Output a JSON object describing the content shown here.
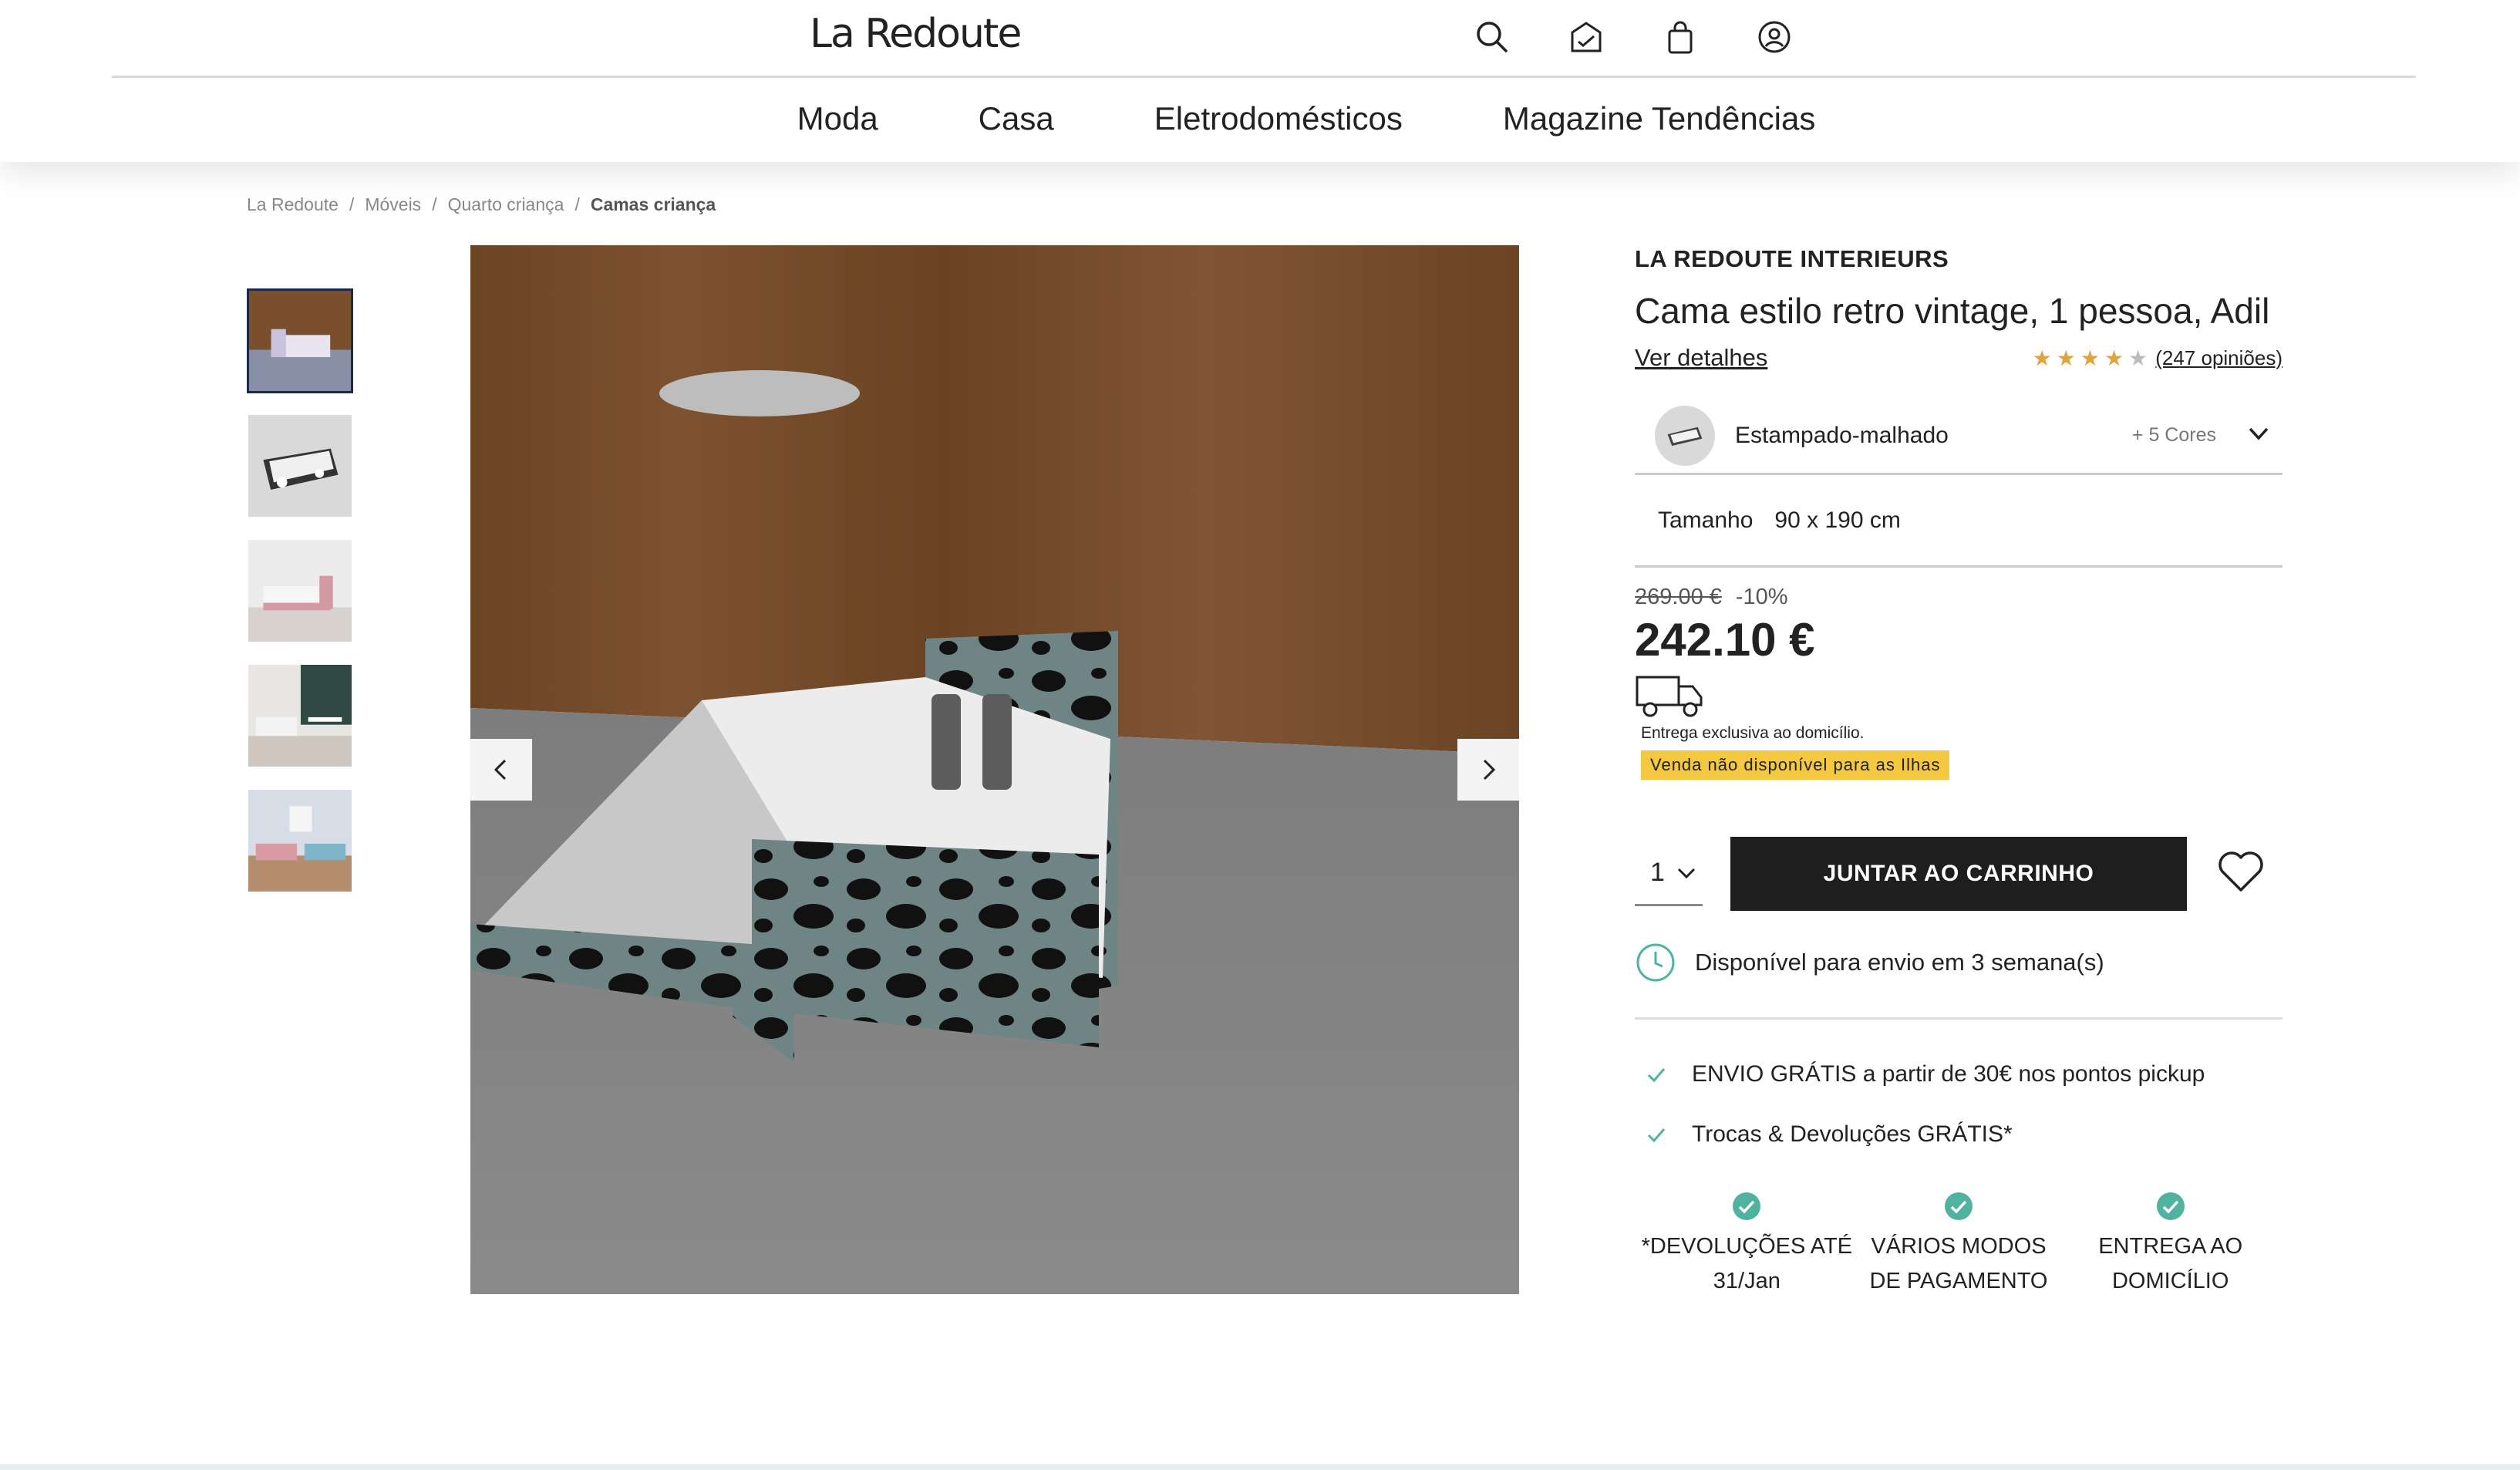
{
  "header": {
    "logo": "La Redoute",
    "icons": [
      "search-icon",
      "card-icon",
      "bag-icon",
      "account-icon"
    ],
    "nav": [
      "Moda",
      "Casa",
      "Eletrodomésticos",
      "Magazine Tendências"
    ]
  },
  "breadcrumb": {
    "items": [
      "La Redoute",
      "Móveis",
      "Quarto criança"
    ],
    "current": "Camas criança",
    "separator": "/"
  },
  "gallery": {
    "thumbnail_count": 5,
    "active_index": 0,
    "video_state": "playing"
  },
  "product": {
    "brand": "LA REDOUTE INTERIEURS",
    "title": "Cama estilo retro vintage, 1 pessoa, Adil",
    "details_link": "Ver detalhes",
    "rating": 4,
    "rating_max": 5,
    "reviews": "(247 opiniões)",
    "color": {
      "name": "Estampado-malhado",
      "more": "+ 5 Cores"
    },
    "size": {
      "label": "Tamanho",
      "value": "90 x 190 cm"
    },
    "price": {
      "old": "269.00 €",
      "discount": "-10%",
      "current": "242.10 €"
    },
    "delivery_note": "Entrega exclusiva ao domicílio.",
    "islands_badge": "Venda não disponível para as Ilhas",
    "quantity": "1",
    "add_to_cart": "JUNTAR AO CARRINHO",
    "availability": "Disponível para envio em 3 semana(s)",
    "perks": [
      "ENVIO GRÁTIS a partir de 30€ nos pontos pickup",
      "Trocas & Devoluções GRÁTIS*"
    ],
    "features": [
      "*DEVOLUÇÕES ATÉ 31/Jan",
      "VÁRIOS MODOS DE PAGAMENTO",
      "ENTREGA AO DOMICÍLIO"
    ]
  },
  "colors": {
    "accent_yellow": "#f5c842",
    "button_dark": "#1e1e1e",
    "teal_check": "#4fb3a0",
    "star": "#e0a33d"
  }
}
